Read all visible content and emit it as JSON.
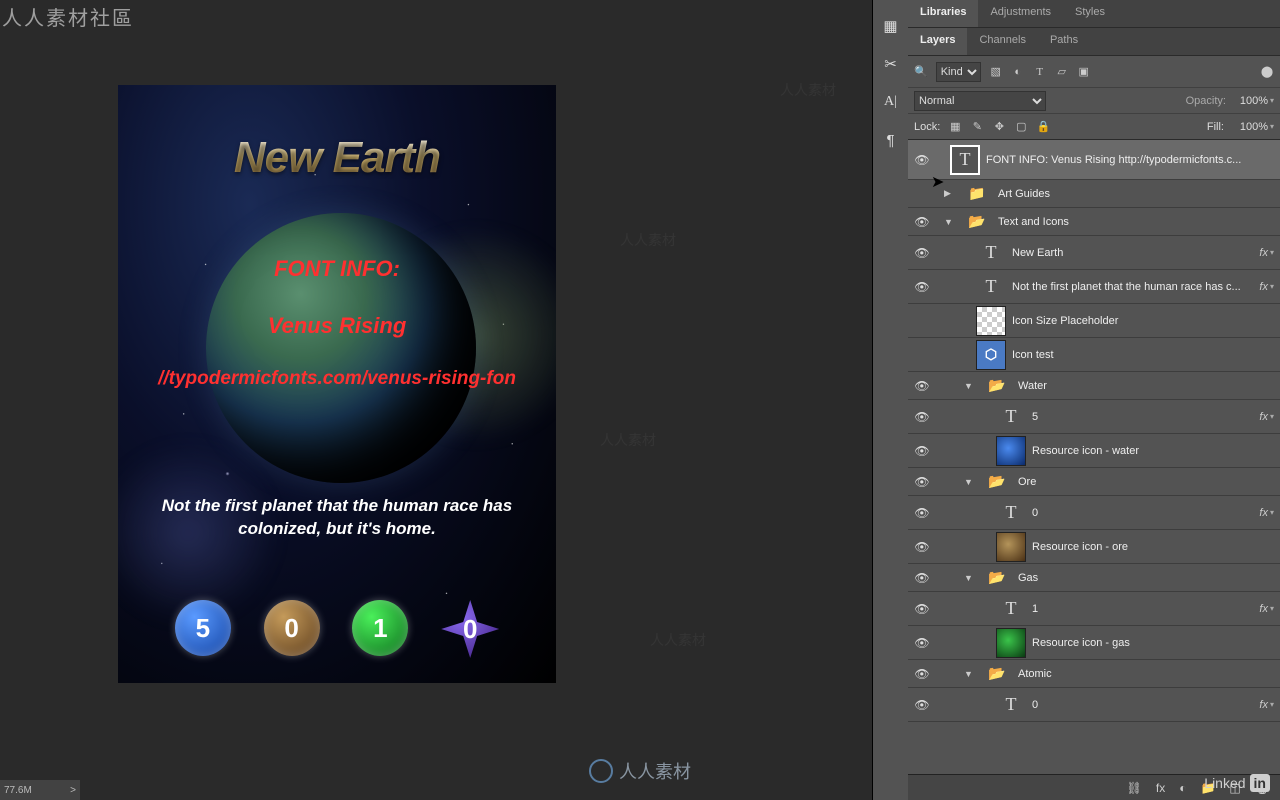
{
  "watermark": {
    "topleft": "人人素材社區",
    "center": "人人素材",
    "linkedin": "Linked",
    "linkedin_box": "in"
  },
  "statusbar": {
    "docsize": "77.6M",
    "arrow": ">"
  },
  "canvas": {
    "title": "New Earth",
    "fontinfo_l1": "FONT INFO:",
    "fontinfo_l2": "Venus Rising",
    "fontinfo_l3": "//typodermicfonts.com/venus-rising-fon",
    "desc": "Not the first planet that the human race has colonized, but it's home.",
    "res_water": "5",
    "res_ore": "0",
    "res_gas": "1",
    "res_atomic": "0"
  },
  "panel": {
    "tabs1": {
      "libraries": "Libraries",
      "adjustments": "Adjustments",
      "styles": "Styles"
    },
    "tabs2": {
      "layers": "Layers",
      "channels": "Channels",
      "paths": "Paths"
    },
    "filter_kind": "Kind",
    "blend": "Normal",
    "opacity_label": "Opacity:",
    "opacity_val": "100%",
    "lock_label": "Lock:",
    "fill_label": "Fill:",
    "fill_val": "100%"
  },
  "layers": {
    "font_info": "FONT INFO:  Venus Rising  http://typodermicfonts.c...",
    "art_guides": "Art Guides",
    "text_icons": "Text and Icons",
    "new_earth": "New Earth",
    "not_first": "Not the first planet that the human race has c...",
    "icon_size": "Icon Size Placeholder",
    "icon_test": "Icon test",
    "water": "Water",
    "water_5": "5",
    "water_res": "Resource icon - water",
    "ore": "Ore",
    "ore_0": "0",
    "ore_res": "Resource icon - ore",
    "gas": "Gas",
    "gas_1": "1",
    "gas_res": "Resource icon - gas",
    "atomic": "Atomic",
    "atomic_0": "0"
  }
}
